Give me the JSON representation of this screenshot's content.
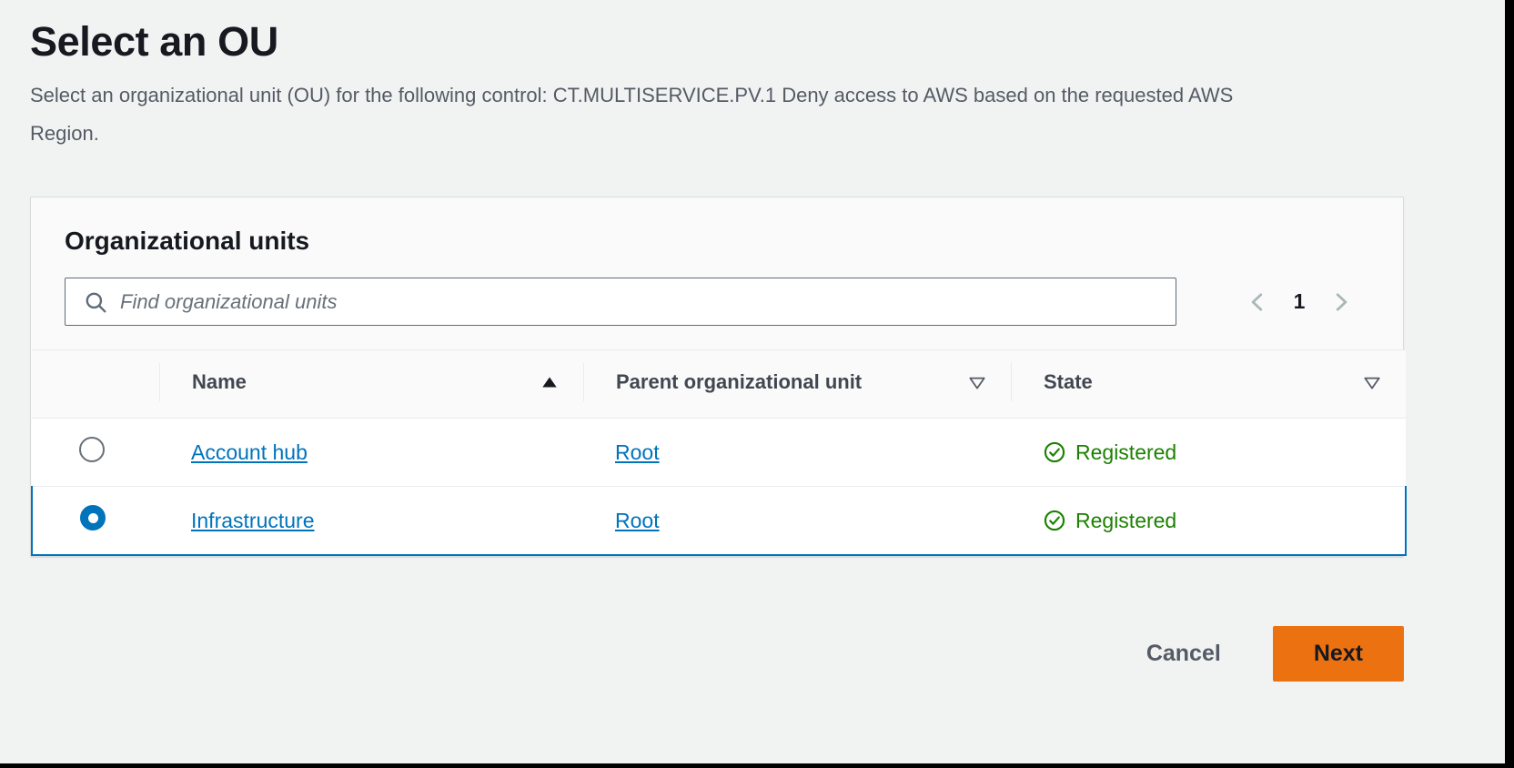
{
  "page": {
    "title": "Select an OU",
    "description": "Select an organizational unit (OU) for the following control: CT.MULTISERVICE.PV.1 Deny access to AWS based on the requested AWS Region."
  },
  "card": {
    "title": "Organizational units"
  },
  "search": {
    "placeholder": "Find organizational units",
    "value": "",
    "icon": "search-icon"
  },
  "pagination": {
    "previous_icon": "chevron-left-icon",
    "next_icon": "chevron-right-icon",
    "current_page": "1"
  },
  "table": {
    "columns": [
      {
        "label": "Name",
        "sort": "ascending",
        "sort_icon": "caret-up-filled-icon"
      },
      {
        "label": "Parent organizational unit",
        "sort": "none",
        "sort_icon": "caret-down-outline-icon"
      },
      {
        "label": "State",
        "sort": "none",
        "sort_icon": "caret-down-outline-icon"
      }
    ],
    "rows": [
      {
        "selected": false,
        "name": "Account hub",
        "parent": "Root",
        "state": "Registered",
        "state_icon": "check-circle-icon"
      },
      {
        "selected": true,
        "name": "Infrastructure",
        "parent": "Root",
        "state": "Registered",
        "state_icon": "check-circle-icon"
      }
    ]
  },
  "footer": {
    "cancel_label": "Cancel",
    "next_label": "Next"
  },
  "colors": {
    "page_background": "#f1f3f3",
    "card_background": "#fafafa",
    "link": "#0073bb",
    "selected_row": "#f1faff",
    "selected_border": "#0073bb",
    "status_green": "#1d8102",
    "primary_button": "#ec7211",
    "text": "#16191f",
    "muted_text": "#545b64"
  }
}
